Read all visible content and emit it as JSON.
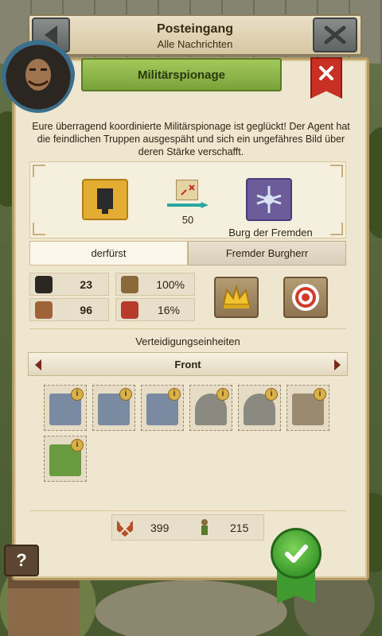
{
  "header": {
    "title": "Posteingang",
    "subtitle": "Alle Nachrichten"
  },
  "dialog": {
    "title": "Militärspionage",
    "intro": "Eure überragend koordinierte Militärspionage ist geglückt! Der Agent hat die feindlichen Truppen ausgespäht und sich ein ungefähres Bild über deren Stärke verschafft."
  },
  "spy": {
    "travel_value": "50",
    "target_castle": "Burg der Fremden"
  },
  "names": {
    "attacker": "derfürst",
    "defender": "Fremder Burgherr"
  },
  "stats": {
    "agents": "23",
    "spy_success": "100%",
    "effort": "96",
    "risk": "16%"
  },
  "units_section": {
    "label": "Verteidigungseinheiten",
    "flank": "Front"
  },
  "units": [
    {
      "kind": "wall-tool",
      "info": "i"
    },
    {
      "kind": "wall-tool",
      "info": "i"
    },
    {
      "kind": "wall-tool",
      "info": "i"
    },
    {
      "kind": "gate-tool",
      "info": "i"
    },
    {
      "kind": "gate-tool",
      "info": "i"
    },
    {
      "kind": "shield-tool",
      "info": "i"
    },
    {
      "kind": "moat-tool",
      "info": "i"
    }
  ],
  "totals": {
    "melee": "399",
    "ranged": "215"
  },
  "help_label": "?",
  "icons": {
    "back": "back-icon",
    "close": "close-icon",
    "agent": "hooded-agent-icon",
    "magnifier": "magnifier-icon",
    "torch": "torch-icon",
    "potion": "potion-icon",
    "crown": "crown-icon",
    "target": "target-icon",
    "check": "checkmark-icon"
  },
  "colors": {
    "accent_green": "#7aa23a",
    "danger_red": "#c83024",
    "panel": "#efe6d0"
  }
}
